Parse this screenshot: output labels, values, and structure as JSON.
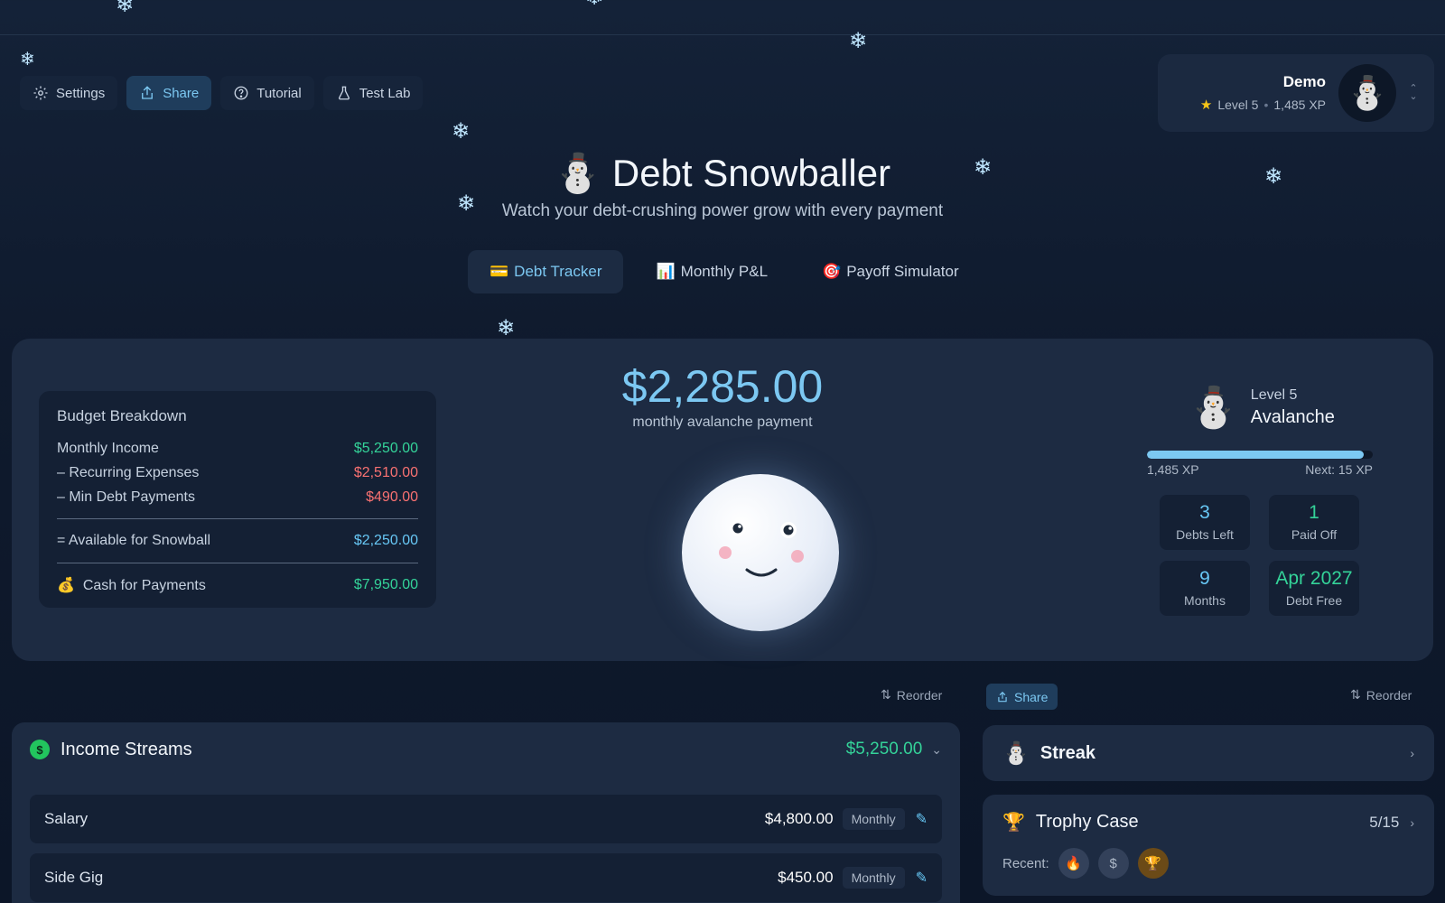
{
  "toolbar": {
    "settings": "Settings",
    "share": "Share",
    "tutorial": "Tutorial",
    "test_lab": "Test Lab"
  },
  "user": {
    "name": "Demo",
    "level": "Level 5",
    "xp": "1,485 XP",
    "avatar": "⛄"
  },
  "header": {
    "title": "⛄ Debt Snowballer",
    "subtitle": "Watch your debt-crushing power grow with every payment"
  },
  "tabs": [
    {
      "icon": "💳",
      "label": "Debt Tracker"
    },
    {
      "icon": "📊",
      "label": "Monthly P&L"
    },
    {
      "icon": "🎯",
      "label": "Payoff Simulator"
    }
  ],
  "budget": {
    "title": "Budget Breakdown",
    "income_label": "Monthly Income",
    "income_value": "$5,250.00",
    "recurring_label": "– Recurring Expenses",
    "recurring_value": "$2,510.00",
    "min_label": "– Min Debt Payments",
    "min_value": "$490.00",
    "available_label": "= Available for Snowball",
    "available_value": "$2,250.00",
    "cash_icon": "💰",
    "cash_label": "Cash for Payments",
    "cash_value": "$7,950.00"
  },
  "payment": {
    "amount": "$2,285.00",
    "label": "monthly avalanche payment"
  },
  "level": {
    "emoji": "⛄",
    "level_text": "Level 5",
    "name": "Avalanche",
    "xp_current": "1,485 XP",
    "xp_next": "Next: 15 XP",
    "xp_progress": 0.96
  },
  "stats": [
    {
      "value": "3",
      "label": "Debts Left"
    },
    {
      "value": "1",
      "label": "Paid Off"
    },
    {
      "value": "9",
      "label": "Months"
    },
    {
      "value": "Apr 2027",
      "label": "Debt Free"
    }
  ],
  "bottom": {
    "reorder_label": "Reorder",
    "share_label": "Share"
  },
  "income": {
    "coin_symbol": "$",
    "title": "Income Streams",
    "total": "$5,250.00",
    "rows": [
      {
        "name": "Salary",
        "amount": "$4,800.00",
        "frequency": "Monthly"
      },
      {
        "name": "Side Gig",
        "amount": "$450.00",
        "frequency": "Monthly"
      }
    ]
  },
  "streak": {
    "icon": "⛄",
    "title": "Streak"
  },
  "trophy": {
    "icon": "🏆",
    "title": "Trophy Case",
    "count": "5/15",
    "recent_label": "Recent:",
    "badges": [
      "🔥",
      "$",
      "🏆"
    ]
  },
  "colors": {
    "accent": "#7cc8f2",
    "positive": "#34d399",
    "negative": "#f87171",
    "panel": "#1d2b42",
    "background": "#0f1a2d"
  }
}
